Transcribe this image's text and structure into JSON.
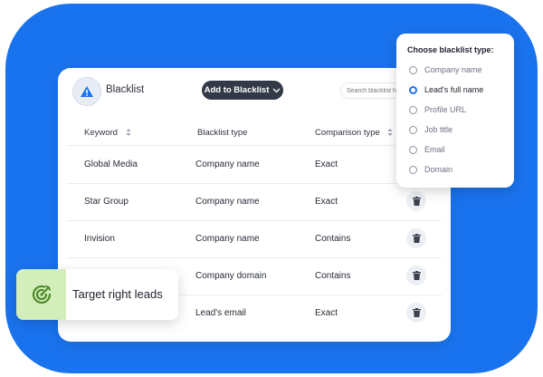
{
  "header": {
    "title": "Blacklist",
    "add_button_label": "Add to Blacklist",
    "search_placeholder": "Search blacklist h"
  },
  "table": {
    "columns": [
      "Keyword",
      "Blacklist type",
      "Comparison type"
    ],
    "rows": [
      {
        "keyword": "Global Media",
        "type": "Company name",
        "comparison": "Exact"
      },
      {
        "keyword": "Star Group",
        "type": "Company name",
        "comparison": "Exact"
      },
      {
        "keyword": "Invision",
        "type": "Company name",
        "comparison": "Contains"
      },
      {
        "keyword": "",
        "type": "Company domain",
        "comparison": "Contains"
      },
      {
        "keyword": "",
        "type": "Lead's email",
        "comparison": "Exact"
      }
    ]
  },
  "dropdown": {
    "title": "Choose blacklist type:",
    "options": [
      "Company name",
      "Lead's full name",
      "Profile URL",
      "Job title",
      "Email",
      "Domain"
    ],
    "selected": "Lead's full name"
  },
  "badge": {
    "text": "Target right leads"
  },
  "colors": {
    "background_blue": "#1a73ee",
    "button_dark": "#323a48",
    "badge_green": "#d3edbb",
    "icon_green": "#4d8a2a"
  },
  "icons": [
    "warning-icon",
    "chevron-down-icon",
    "sort-icon",
    "trash-icon",
    "target-refresh-icon"
  ]
}
